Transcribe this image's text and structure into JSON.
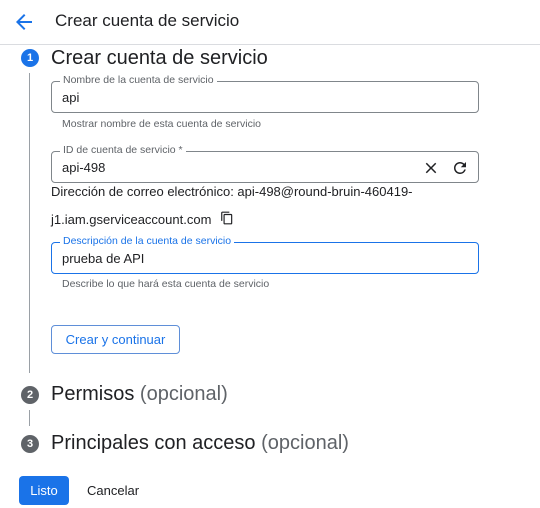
{
  "header": {
    "title": "Crear cuenta de servicio"
  },
  "steps": [
    {
      "number": "1",
      "title": "Crear cuenta de servicio",
      "optional": ""
    },
    {
      "number": "2",
      "title": "Permisos",
      "optional": "(opcional)"
    },
    {
      "number": "3",
      "title": "Principales con acceso",
      "optional": "(opcional)"
    }
  ],
  "form": {
    "name": {
      "label": "Nombre de la cuenta de servicio",
      "value": "api",
      "hint": "Mostrar nombre de esta cuenta de servicio"
    },
    "id": {
      "label": "ID de cuenta de servicio *",
      "value": "api-498"
    },
    "email": {
      "line1": "Dirección de correo electrónico: api-498@round-bruin-460419-",
      "line2": "j1.iam.gserviceaccount.com"
    },
    "description": {
      "label": "Descripción de la cuenta de servicio",
      "value": "prueba de API",
      "hint": "Describe lo que hará esta cuenta de servicio"
    }
  },
  "buttons": {
    "create_continue": "Crear y continuar",
    "done": "Listo",
    "cancel": "Cancelar"
  },
  "colors": {
    "accent": "#1a73e8",
    "text": "#202124",
    "muted": "#5f6368",
    "border": "#80868b"
  },
  "icons": {
    "back": "arrow-left-icon",
    "clear": "close-icon",
    "regenerate": "refresh-icon",
    "copy": "copy-icon"
  }
}
